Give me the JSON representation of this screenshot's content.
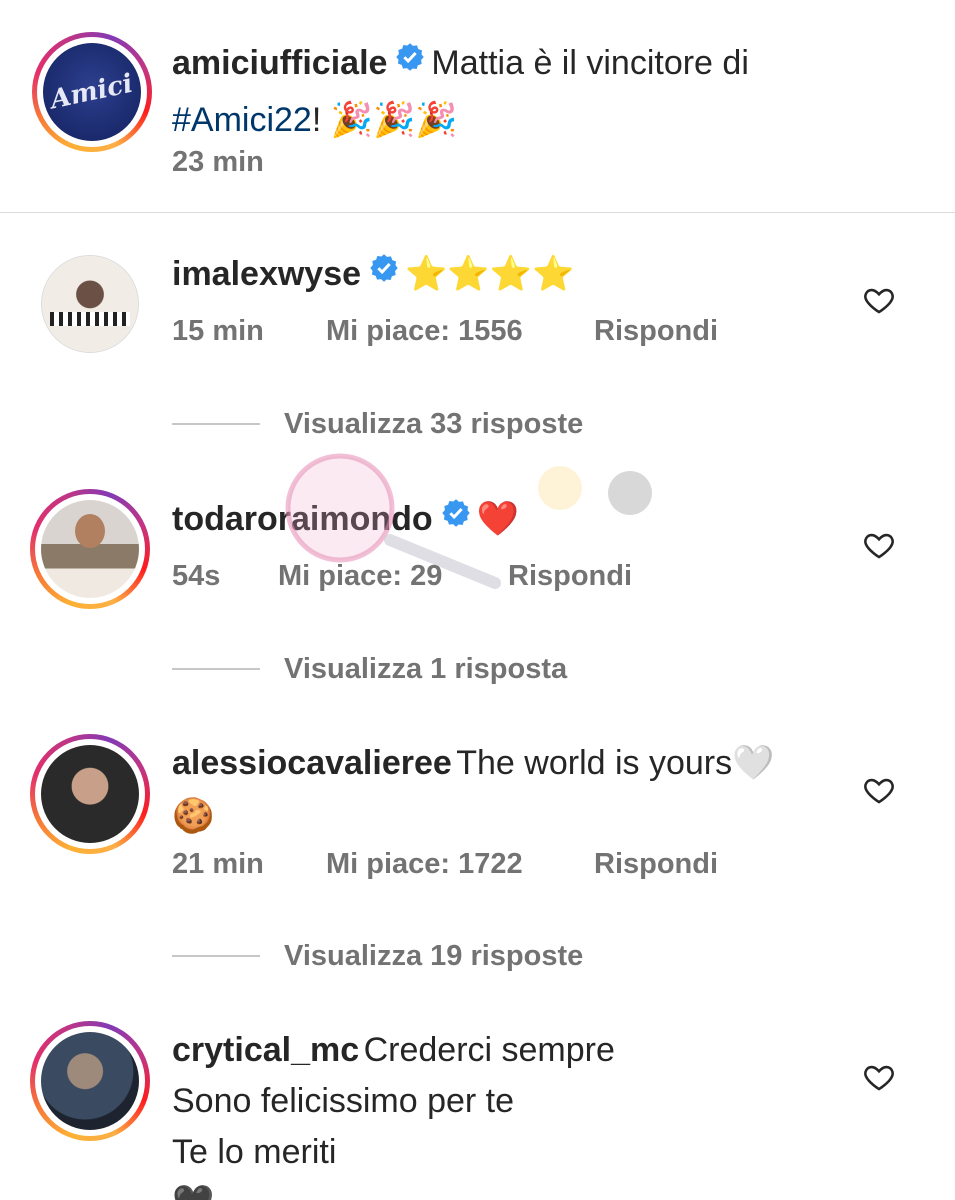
{
  "post": {
    "username": "amiciufficiale",
    "caption_text": "Mattia è il vincitore di",
    "hashtag": "#Amici22",
    "caption_end": "! 🎉🎉🎉",
    "time": "23 min",
    "avatar_logo_text": "Amici"
  },
  "comments": [
    {
      "username": "imalexwyse",
      "verified": true,
      "text": "⭐⭐⭐⭐",
      "time": "15 min",
      "likes": "Mi piace: 1556",
      "reply": "Rispondi",
      "view_replies": "Visualizza 33 risposte"
    },
    {
      "username": "todaroraimondo",
      "verified": true,
      "text": "❤️",
      "time": "54s",
      "likes": "Mi piace: 29",
      "reply": "Rispondi",
      "view_replies": "Visualizza 1 risposta"
    },
    {
      "username": "alessiocavalieree",
      "verified": false,
      "text": "The world is yours🤍",
      "text_line2": "🍪",
      "time": "21 min",
      "likes": "Mi piace: 1722",
      "reply": "Rispondi",
      "view_replies": "Visualizza 19 risposte"
    },
    {
      "username": "crytical_mc",
      "verified": false,
      "text": "Crederci sempre",
      "text_line2": "Sono felicissimo per te",
      "text_line3": "Te lo meriti",
      "text_line4": "🖤"
    }
  ],
  "colors": {
    "verified_blue": "#3897f0",
    "hashtag_blue": "#00376b",
    "meta_gray": "#737373"
  }
}
